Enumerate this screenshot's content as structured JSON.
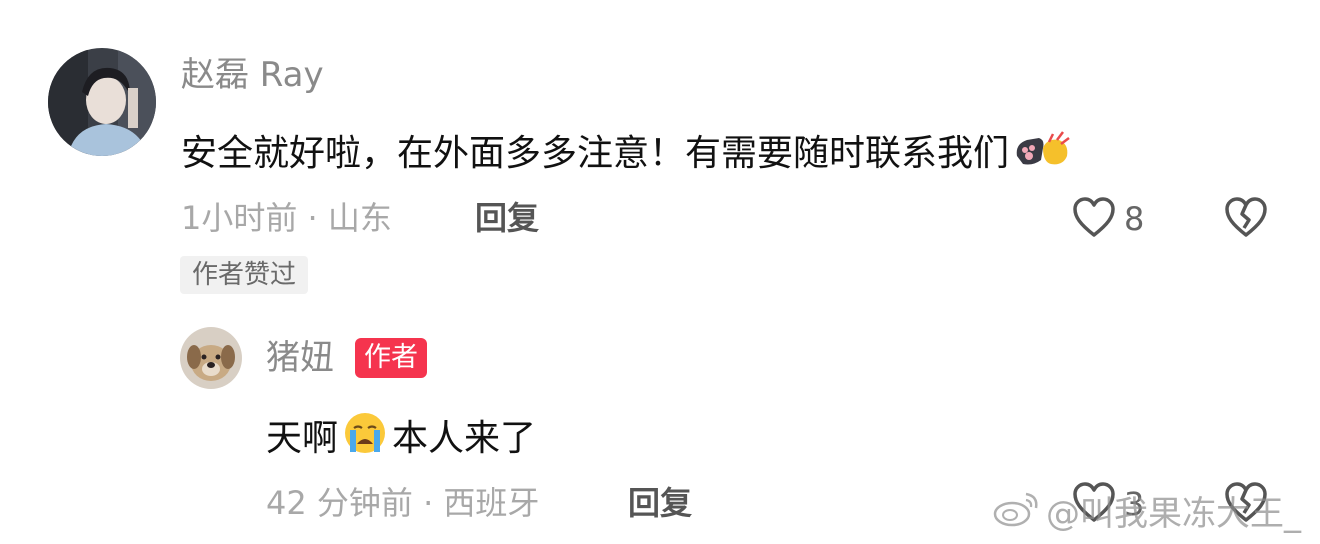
{
  "comments": [
    {
      "username": "赵磊 Ray",
      "text": "安全就好啦，在外面多多注意！有需要随时联系我们",
      "text_emoji": "fist-bump-emoji",
      "time_location": "1小时前 · 山东",
      "reply_label": "回复",
      "likes": "8",
      "author_liked_label": "作者赞过"
    },
    {
      "username": "猪妞",
      "author_badge": "作者",
      "text_before": "天啊",
      "text_emoji": "loudly-crying-emoji",
      "text_after": "本人来了",
      "time_location": "42 分钟前 · 西班牙",
      "reply_label": "回复",
      "likes": "3"
    }
  ],
  "watermark": {
    "text": "@叫我果冻大王_",
    "icon": "weibo-logo-icon"
  },
  "colors": {
    "author_badge_bg": "#f5344e",
    "username": "#8a8a8a",
    "text": "#111111",
    "meta": "#a8a8a8"
  }
}
